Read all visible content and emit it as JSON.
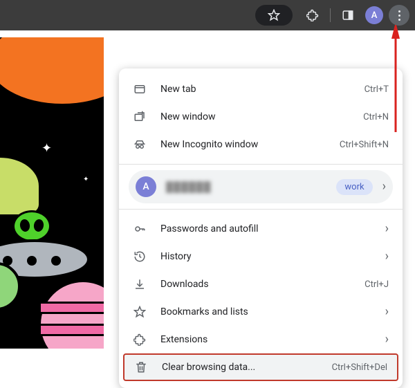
{
  "toolbar": {
    "avatar_letter": "A"
  },
  "menu": {
    "new_tab": {
      "label": "New tab",
      "shortcut": "Ctrl+T"
    },
    "new_window": {
      "label": "New window",
      "shortcut": "Ctrl+N"
    },
    "incognito": {
      "label": "New Incognito window",
      "shortcut": "Ctrl+Shift+N"
    },
    "profile": {
      "letter": "A",
      "name": "██████",
      "tag": "work"
    },
    "passwords": {
      "label": "Passwords and autofill"
    },
    "history": {
      "label": "History"
    },
    "downloads": {
      "label": "Downloads",
      "shortcut": "Ctrl+J"
    },
    "bookmarks": {
      "label": "Bookmarks and lists"
    },
    "extensions": {
      "label": "Extensions"
    },
    "clear": {
      "label": "Clear browsing data...",
      "shortcut": "Ctrl+Shift+Del"
    }
  }
}
